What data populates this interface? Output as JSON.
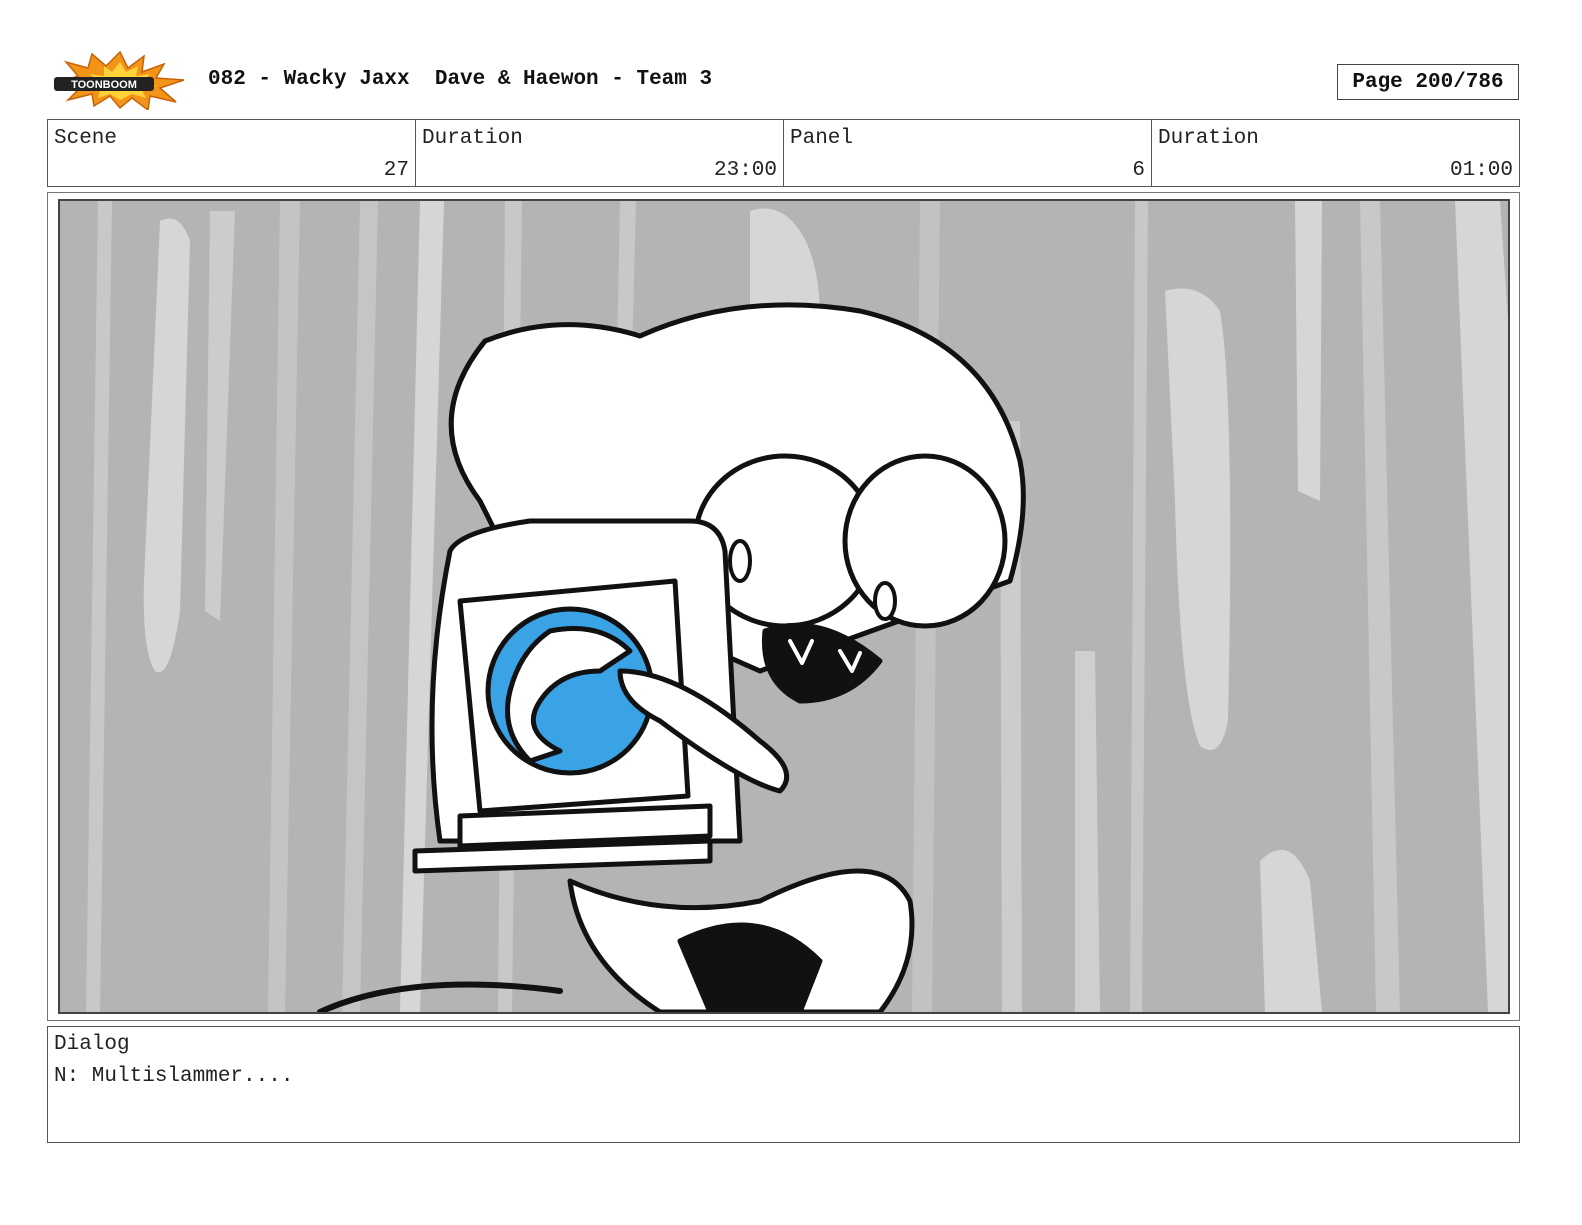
{
  "header": {
    "logo_text": "TOONBOOM",
    "title": "082 - Wacky Jaxx  Dave & Haewon - Team 3",
    "page": "Page 200/786"
  },
  "info": {
    "scene_label": "Scene",
    "scene_value": "27",
    "duration_label": "Duration",
    "duration_value": "23:00",
    "panel_label": "Panel",
    "panel_value": "6",
    "panel_duration_label": "Duration",
    "panel_duration_value": "01:00"
  },
  "dialog": {
    "label": "Dialog",
    "text": "N: Multislammer...."
  },
  "colors": {
    "panel_bg": "#b4b4b4",
    "streak": "#d6d6d6",
    "accent_blue": "#3aa3e6",
    "logo_orange": "#f29418"
  }
}
